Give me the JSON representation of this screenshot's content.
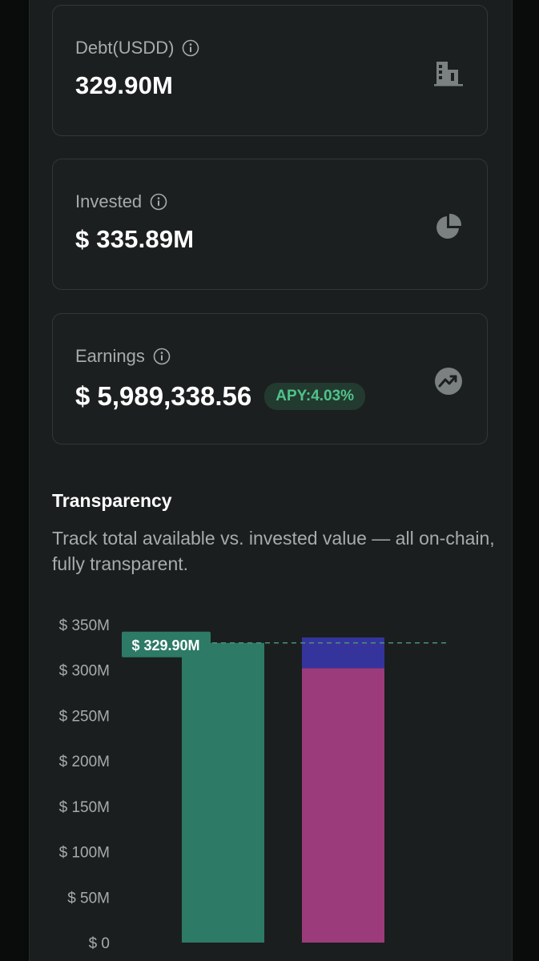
{
  "cards": {
    "debt": {
      "label": "Debt(USDD)",
      "value": "329.90M"
    },
    "invested": {
      "label": "Invested",
      "value": "$ 335.89M"
    },
    "earnings": {
      "label": "Earnings",
      "value": "$ 5,989,338.56",
      "apy": "APY:4.03%"
    }
  },
  "transparency": {
    "title": "Transparency",
    "description": "Track total available vs. invested value — all on-chain, fully transparent."
  },
  "colors": {
    "accent_green": "#2d7a66",
    "magenta": "#9b3b7b",
    "indigo": "#35349c",
    "apy_text": "#4fc38a"
  },
  "chart_data": {
    "type": "bar",
    "stacked": true,
    "ylim": [
      0,
      350
    ],
    "yticks": [
      0,
      50,
      100,
      150,
      200,
      250,
      300,
      350
    ],
    "ytick_labels": [
      "$ 0",
      "$ 50M",
      "$ 100M",
      "$ 150M",
      "$ 200M",
      "$ 250M",
      "$ 300M",
      "$ 350M"
    ],
    "bars": [
      {
        "segments": [
          {
            "value": 329.9,
            "color": "#2d7a66"
          }
        ]
      },
      {
        "segments": [
          {
            "value": 302,
            "color": "#9b3b7b"
          },
          {
            "value": 33.89,
            "color": "#35349c"
          }
        ]
      }
    ],
    "reference_line": {
      "value": 329.9,
      "label": "$ 329.90M"
    }
  }
}
